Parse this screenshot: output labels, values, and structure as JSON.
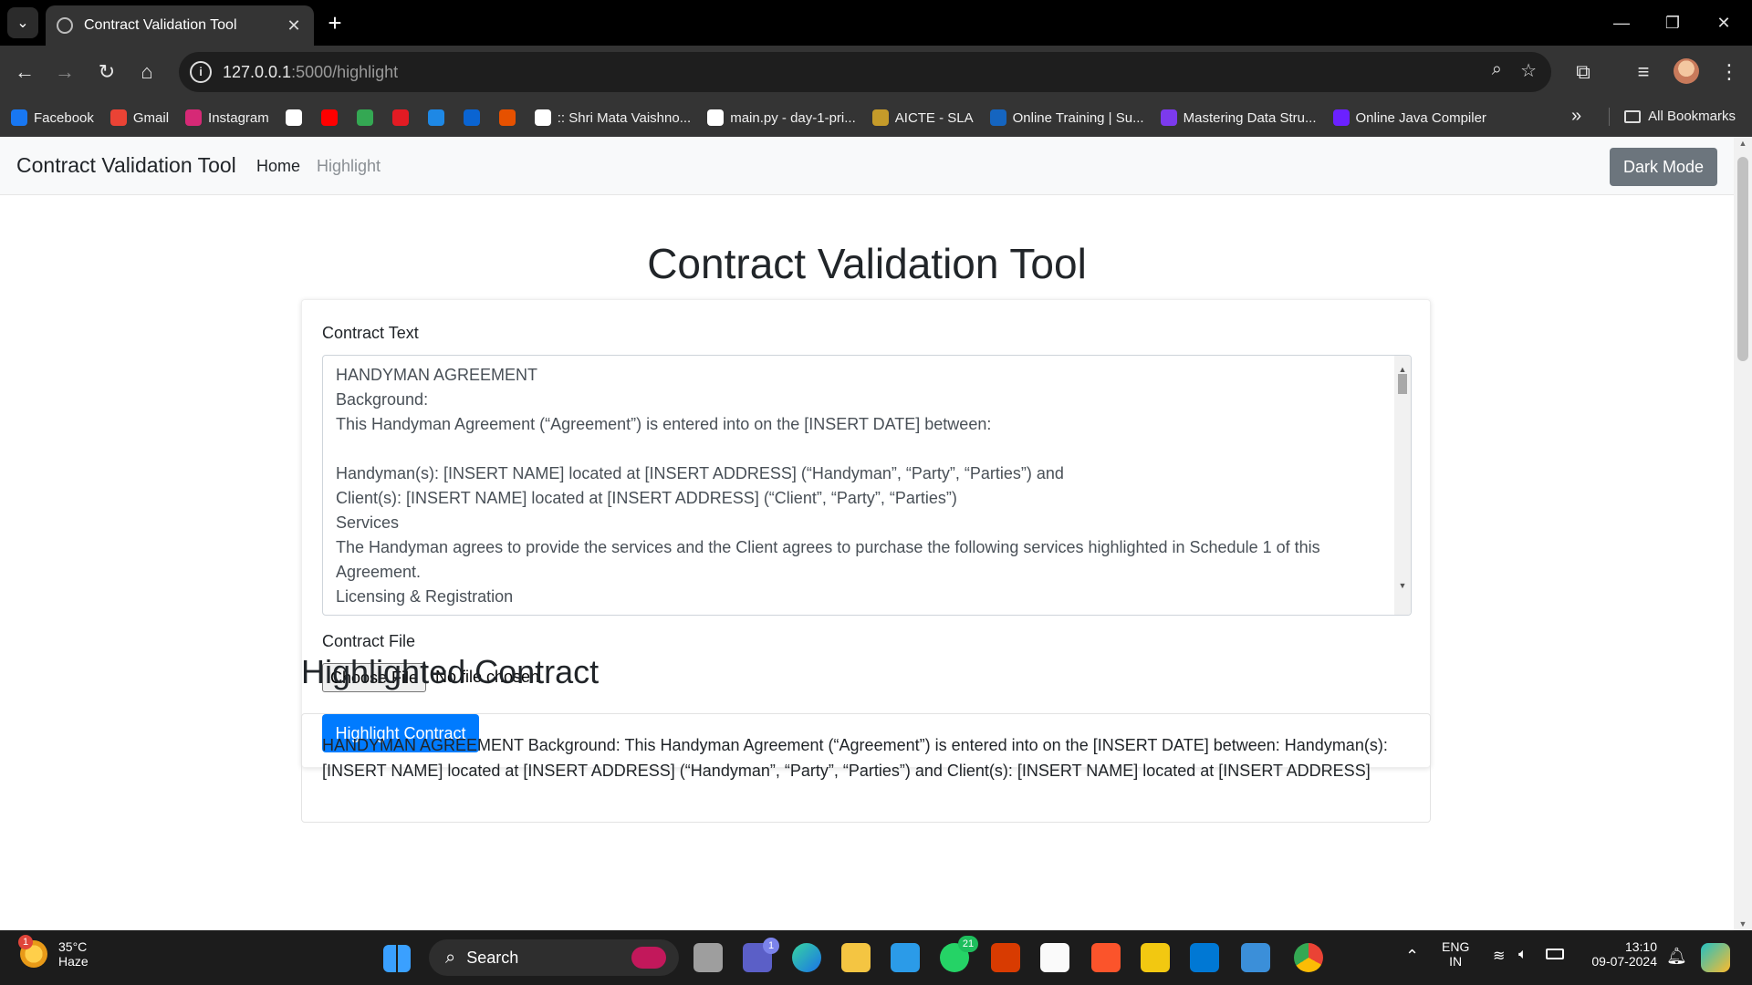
{
  "browser": {
    "tab_title": "Contract Validation Tool",
    "new_tab": "+",
    "close_tab": "✕",
    "url_host": "127.0.0.1",
    "url_path": ":5000/highlight",
    "window_controls": {
      "minimize": "—",
      "restore": "❐",
      "close": "✕"
    },
    "bookmarks": [
      {
        "label": "Facebook",
        "icon": "facebook-icon",
        "color": "#1877f2"
      },
      {
        "label": "Gmail",
        "icon": "gmail-icon",
        "color": "#ea4335"
      },
      {
        "label": "Instagram",
        "icon": "instagram-icon",
        "color": "#d62976"
      },
      {
        "label": "",
        "icon": "google-icon",
        "color": "#ffffff"
      },
      {
        "label": "",
        "icon": "youtube-icon",
        "color": "#ff0000"
      },
      {
        "label": "",
        "icon": "maps-icon",
        "color": "#34a853"
      },
      {
        "label": "",
        "icon": "pnb-icon",
        "color": "#e21b23"
      },
      {
        "label": "",
        "icon": "app-icon",
        "color": "#1e88e5"
      },
      {
        "label": "",
        "icon": "outlook-icon",
        "color": "#0a64d2"
      },
      {
        "label": "",
        "icon": "bird-icon",
        "color": "#e65100"
      },
      {
        "label": ":: Shri Mata Vaishno...",
        "icon": "globe-icon",
        "color": "#ffffff"
      },
      {
        "label": "main.py - day-1-pri...",
        "icon": "replit-icon",
        "color": "#ffffff"
      },
      {
        "label": "AICTE - SLA",
        "icon": "aicte-icon",
        "color": "#c59b2a"
      },
      {
        "label": "Online Training | Su...",
        "icon": "ist-icon",
        "color": "#1565c0"
      },
      {
        "label": "Mastering Data Stru...",
        "icon": "course-icon",
        "color": "#7c3aed"
      },
      {
        "label": "Online Java Compiler",
        "icon": "compiler-icon",
        "color": "#6b21ff"
      }
    ],
    "more_bookmarks": "»",
    "all_bookmarks": "All Bookmarks"
  },
  "navbar": {
    "brand": "Contract Validation Tool",
    "home": "Home",
    "highlight": "Highlight",
    "dark_mode": "Dark Mode"
  },
  "main": {
    "title": "Contract Validation Tool",
    "contract_text_label": "Contract Text",
    "contract_text_lines": [
      "HANDYMAN AGREEMENT",
      "Background:",
      "This Handyman Agreement (“Agreement”) is entered into on the [INSERT DATE] between:",
      "",
      "Handyman(s): [INSERT NAME] located at [INSERT ADDRESS] (“Handyman”, “Party”, “Parties”) and",
      "Client(s): [INSERT NAME] located at [INSERT ADDRESS] (“Client”, “Party”, “Parties”)",
      "Services",
      "The Handyman agrees to provide the services and the Client agrees to purchase the following services highlighted in Schedule 1 of this",
      "Agreement.",
      "Licensing & Registration"
    ],
    "contract_file_label": "Contract File",
    "choose_file": "Choose File",
    "no_file": "No file chosen",
    "submit": "Highlight Contract",
    "highlighted_title": "Highlighted Contract",
    "highlighted_lines": [
      "HANDYMAN AGREEMENT Background: This Handyman Agreement (“Agreement”) is entered into on the [INSERT DATE] between: Handyman(s):",
      "[INSERT NAME] located at [INSERT ADDRESS] (“Handyman”, “Party”, “Parties”) and Client(s): [INSERT NAME] located at [INSERT ADDRESS]"
    ]
  },
  "taskbar": {
    "temperature": "35°C",
    "condition": "Haze",
    "weather_badge": "1",
    "search": "Search",
    "teams_badge": "1",
    "whatsapp_badge": "21",
    "lang1": "ENG",
    "lang2": "IN",
    "time": "13:10",
    "date": "09-07-2024"
  }
}
